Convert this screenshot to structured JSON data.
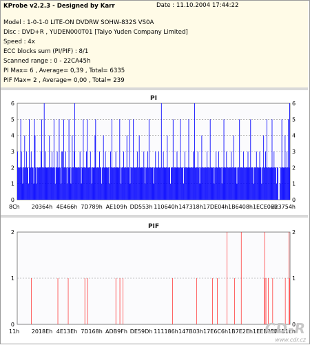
{
  "header": {
    "title": "KProbe v2.2.3 - Designed by Karr",
    "date": "Date : 11.10.2004 17:44:22",
    "lines": [
      "Model : 1-0-1-0 LITE-ON DVDRW SOHW-832S  VS0A",
      "Disc : DVD+R , YUDEN000T01 [Taiyo Yuden Company Limited]",
      "Speed : 4x",
      "ECC blocks sum (PI/PIF) : 8/1",
      "Scanned range : 0 - 22CA45h",
      "PI Max= 6 , Average= 0,39 , Total= 6335",
      "PIF Max= 2 , Average= 0,00 , Total= 239"
    ]
  },
  "watermark": {
    "logo": "CD-R",
    "url": "www.cdr.cz"
  },
  "chart_data": [
    {
      "type": "bar",
      "title": "PI",
      "ylim": [
        0,
        6
      ],
      "yticks": [
        0,
        1,
        2,
        3,
        4,
        5,
        6
      ],
      "x_tick_labels": [
        "8Ch",
        "20364h",
        "4E466h",
        "7D789h",
        "AE109h",
        "DD553h",
        "110640h",
        "147318h",
        "17DE04h",
        "1B6408h",
        "1ECE06h",
        "223754h"
      ],
      "color": "#0000ff",
      "grid": "dashed-horizontal",
      "values": [
        3,
        2,
        2,
        2,
        2,
        5,
        3,
        2,
        1,
        2,
        2,
        4,
        2,
        2,
        3,
        2,
        2,
        1,
        5,
        2,
        2,
        3,
        2,
        2,
        2,
        1,
        5,
        4,
        2,
        1,
        2,
        2,
        2,
        2,
        2,
        2,
        3,
        5,
        2,
        2,
        2,
        6,
        2,
        3,
        2,
        2,
        2,
        2,
        2,
        4,
        2,
        2,
        2,
        3,
        2,
        2,
        5,
        2,
        1,
        2,
        2,
        3,
        2,
        2,
        5,
        2,
        2,
        1,
        3,
        3,
        2,
        5,
        2,
        2,
        3,
        2,
        1,
        2,
        2,
        5,
        2,
        2,
        1,
        2,
        4,
        2,
        2,
        3,
        6,
        2,
        2,
        2,
        2,
        2,
        2,
        2,
        3,
        2,
        1,
        2,
        2,
        5,
        2,
        2,
        2,
        2,
        3,
        5,
        2,
        2,
        2,
        2,
        3,
        2,
        1,
        2,
        2,
        2,
        2,
        4,
        5,
        2,
        2,
        2,
        2,
        2,
        3,
        2,
        2,
        1,
        2,
        2,
        4,
        2,
        2,
        3,
        2,
        2,
        2,
        2,
        2,
        1,
        2,
        3,
        2,
        5,
        2,
        2,
        2,
        2,
        2,
        3,
        2,
        2,
        2,
        2,
        2,
        5,
        2,
        1,
        2,
        2,
        2,
        3,
        2,
        2,
        2,
        2,
        4,
        2,
        2,
        2,
        5,
        1,
        2,
        2,
        2,
        2,
        5,
        2,
        2,
        2,
        2,
        2,
        3,
        2,
        2,
        4,
        2,
        2,
        2,
        2,
        2,
        2,
        3,
        2,
        1,
        2,
        2,
        2,
        3,
        2,
        5,
        2,
        2,
        2,
        2,
        2,
        2,
        1,
        2,
        2,
        3,
        2,
        2,
        2,
        2,
        3,
        2,
        2,
        2,
        6,
        2,
        2,
        3,
        2,
        2,
        2,
        2,
        2,
        4,
        2,
        2,
        2,
        2,
        1,
        2,
        2,
        2,
        5,
        2,
        2,
        2,
        2,
        2,
        3,
        2,
        2,
        2,
        2,
        5,
        2,
        2,
        2,
        2,
        1,
        2,
        3,
        2,
        2,
        2,
        2,
        2,
        5,
        2,
        2,
        2,
        2,
        2,
        2,
        3,
        2,
        6,
        2,
        2,
        2,
        2,
        3,
        2,
        2,
        1,
        2,
        2,
        4,
        2,
        2,
        2,
        2,
        2,
        2,
        2,
        3,
        2,
        2,
        2,
        2,
        5,
        2,
        2,
        2,
        2,
        2,
        1,
        2,
        2,
        3,
        2,
        2,
        2,
        3,
        2,
        2,
        2,
        2,
        1,
        2,
        2,
        5,
        2,
        2,
        2,
        3,
        2,
        2,
        2,
        2,
        2,
        2,
        3,
        2,
        2,
        2,
        4,
        2,
        2,
        2,
        2,
        1,
        2,
        2,
        2,
        5,
        2,
        2,
        2,
        2,
        2,
        3,
        2,
        2,
        2,
        2,
        2,
        2,
        3,
        2,
        2,
        2,
        5,
        2,
        2,
        2,
        2,
        1,
        2,
        2,
        2,
        3,
        2,
        2,
        2,
        2,
        3,
        2,
        2,
        1,
        2,
        2,
        4,
        2,
        2,
        3,
        2,
        5,
        2,
        2,
        2,
        2,
        2,
        2,
        2,
        5,
        2,
        2,
        3,
        2,
        2,
        2,
        1,
        2,
        2,
        0,
        0,
        1,
        2,
        2,
        5,
        2,
        2,
        2,
        2,
        4,
        2,
        2,
        3,
        2,
        5,
        2,
        6
      ]
    },
    {
      "type": "bar",
      "title": "PIF",
      "ylim": [
        0,
        2
      ],
      "yticks": [
        0,
        1,
        2
      ],
      "x_tick_labels": [
        "11h",
        "2018Eh",
        "4E13Eh",
        "7D168h",
        "ADB9Fh",
        "DE59Dh",
        "111186h",
        "147B03h",
        "17E6C6h",
        "1B7E2Eh",
        "1EEB05h",
        "225B1Eh"
      ],
      "color": "#ff0000",
      "grid": "dashed-horizontal",
      "values": [
        0,
        0,
        0,
        0,
        0,
        0,
        0,
        0,
        0,
        0,
        0,
        0,
        0,
        0,
        0,
        0,
        0,
        0,
        0,
        0,
        0,
        0,
        0,
        0,
        0,
        0,
        0,
        0,
        0,
        0,
        0,
        1,
        0,
        0,
        0,
        0,
        0,
        0,
        0,
        0,
        0,
        0,
        0,
        0,
        0,
        0,
        0,
        0,
        0,
        0,
        0,
        0,
        0,
        0,
        0,
        0,
        0,
        0,
        0,
        0,
        0,
        0,
        0,
        0,
        0,
        0,
        0,
        0,
        0,
        0,
        0,
        0,
        0,
        0,
        0,
        0,
        0,
        0,
        0,
        0,
        0,
        0,
        0,
        0,
        0,
        0,
        0,
        0,
        0,
        0,
        1,
        0,
        0,
        0,
        0,
        0,
        0,
        0,
        0,
        0,
        0,
        0,
        0,
        0,
        0,
        0,
        0,
        0,
        0,
        0,
        0,
        0,
        0,
        1,
        0,
        0,
        0,
        0,
        0,
        0,
        0,
        0,
        0,
        0,
        0,
        0,
        0,
        0,
        0,
        0,
        0,
        0,
        0,
        0,
        0,
        0,
        0,
        0,
        0,
        0,
        0,
        0,
        0,
        0,
        0,
        0,
        0,
        0,
        0,
        0,
        1,
        0,
        0,
        0,
        0,
        0,
        1,
        0,
        0,
        0,
        0,
        0,
        0,
        0,
        0,
        0,
        0,
        0,
        0,
        0,
        0,
        0,
        0,
        0,
        0,
        0,
        0,
        0,
        0,
        0,
        0,
        0,
        0,
        0,
        0,
        0,
        0,
        0,
        0,
        0,
        0,
        0,
        0,
        0,
        0,
        0,
        0,
        0,
        0,
        0,
        0,
        0,
        0,
        0,
        0,
        0,
        0,
        0,
        0,
        0,
        0,
        0,
        0,
        0,
        0,
        0,
        0,
        0,
        0,
        1,
        0,
        0,
        0,
        0,
        0,
        0,
        0,
        0,
        1,
        0,
        0,
        0,
        0,
        0,
        0,
        1,
        0,
        0,
        0,
        0,
        0,
        0,
        0,
        0,
        0,
        0,
        0,
        0,
        0,
        0,
        0,
        0,
        0,
        0,
        0,
        0,
        0,
        0,
        0,
        0,
        0,
        0,
        0,
        0,
        0,
        0,
        0,
        0,
        0,
        0,
        0,
        0,
        0,
        0,
        0,
        0,
        0,
        0,
        0,
        0,
        0,
        0,
        0,
        0,
        0,
        0,
        0,
        0,
        0,
        0,
        0,
        0,
        0,
        0,
        0,
        0,
        0,
        0,
        0,
        0,
        0,
        0,
        0,
        0,
        0,
        0,
        0,
        0,
        0,
        0,
        0,
        0,
        0,
        0,
        0,
        0,
        0,
        0,
        0,
        0,
        0,
        0,
        0,
        0,
        0,
        0,
        0,
        0,
        0,
        0,
        0,
        0,
        0,
        0,
        0,
        0,
        0,
        0,
        0,
        0,
        0,
        0,
        0,
        0,
        0,
        1,
        0,
        0,
        0,
        0,
        0,
        0,
        0,
        0,
        0,
        0,
        0,
        0,
        0,
        0,
        0,
        0,
        0,
        0,
        0,
        0,
        0,
        0,
        0,
        0,
        0,
        0,
        0,
        0,
        0,
        0,
        0,
        0,
        0,
        0,
        0,
        0,
        0,
        0,
        0,
        0,
        0,
        0,
        0,
        0,
        0,
        0,
        0,
        0,
        0,
        0,
        0,
        0,
        0,
        1,
        0,
        0,
        0,
        0,
        0,
        0,
        0,
        0,
        0,
        0,
        0,
        0,
        0,
        0,
        0,
        0,
        0,
        0,
        0,
        0,
        0,
        0,
        0,
        0,
        0,
        0,
        0,
        0,
        0,
        0,
        0,
        0,
        0,
        0,
        1,
        0,
        0,
        0,
        0,
        0,
        0,
        0,
        0,
        0,
        0,
        1,
        0,
        0,
        0,
        0,
        0,
        0,
        0,
        0,
        0,
        0,
        0,
        0,
        0,
        0,
        0,
        0,
        0,
        0,
        0,
        0,
        2,
        0,
        0,
        0,
        0,
        0,
        0,
        0,
        0,
        0,
        0,
        0,
        0,
        0,
        0,
        0,
        0,
        1,
        0,
        0,
        0,
        0,
        0,
        0,
        0,
        0,
        0,
        0,
        0,
        0,
        0,
        0,
        2,
        0,
        0,
        0,
        0,
        0,
        0,
        0,
        0,
        0,
        0,
        0,
        0,
        0,
        0,
        0,
        0,
        0,
        0,
        0,
        0,
        0,
        0,
        0,
        0,
        0,
        0,
        0,
        0,
        0,
        0,
        0,
        0,
        0,
        0,
        0,
        0,
        0,
        0,
        0,
        0,
        0,
        0,
        0,
        0,
        0,
        0,
        0,
        0,
        0,
        0,
        0,
        2,
        1,
        0,
        1,
        0,
        0,
        0,
        0,
        1,
        0,
        0,
        0,
        0,
        0,
        0,
        0,
        0,
        0,
        1,
        0,
        0,
        0,
        0,
        0,
        0,
        0,
        0,
        0,
        0,
        0,
        0,
        0,
        0,
        0,
        0,
        0,
        0,
        0,
        0,
        0,
        0,
        0,
        0,
        0,
        0,
        0,
        1,
        0,
        0,
        0,
        0,
        0,
        0,
        0,
        2,
        0,
        1
      ]
    }
  ]
}
